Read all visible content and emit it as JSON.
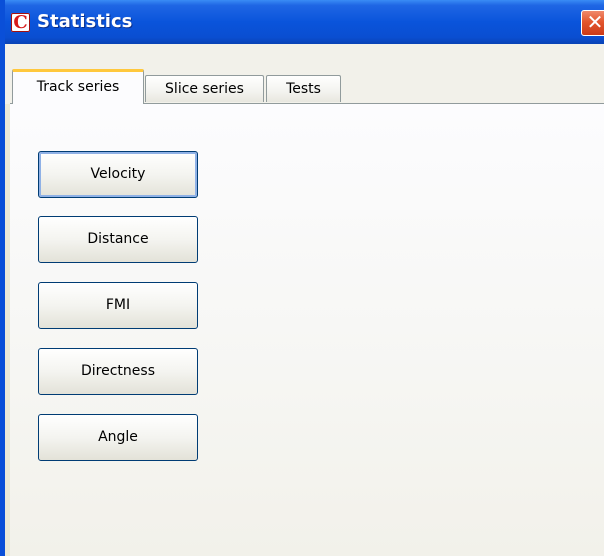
{
  "window": {
    "title": "Statistics",
    "app_icon_glyph": "C",
    "close_glyph": "✕"
  },
  "tabs": [
    {
      "label": "Track series",
      "active": true
    },
    {
      "label": "Slice series",
      "active": false
    },
    {
      "label": "Tests",
      "active": false
    }
  ],
  "buttons": [
    {
      "label": "Velocity"
    },
    {
      "label": "Distance"
    },
    {
      "label": "FMI"
    },
    {
      "label": "Directness"
    },
    {
      "label": "Angle"
    }
  ],
  "colors": {
    "titlebar": "#0a54db",
    "close_button": "#e3562d",
    "active_tab_highlight": "#ffc83d",
    "button_border": "#003c74"
  }
}
